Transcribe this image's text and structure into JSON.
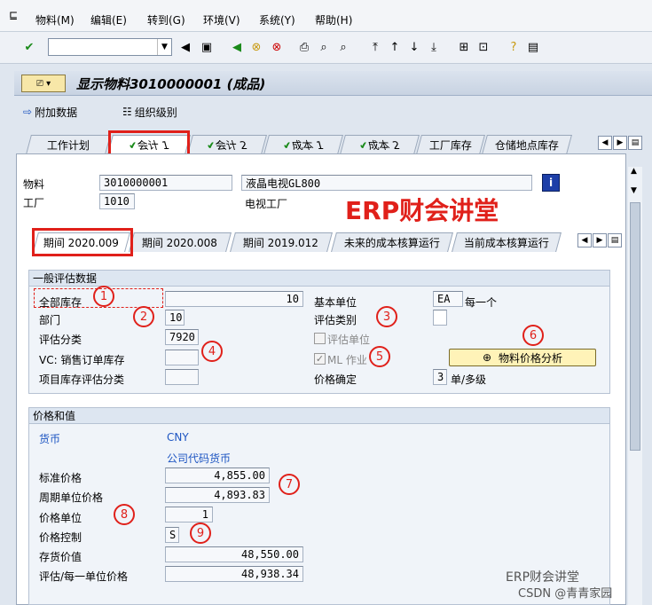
{
  "menu": [
    "物料(M)",
    "编辑(E)",
    "转到(G)",
    "环境(V)",
    "系统(Y)",
    "帮助(H)"
  ],
  "title": "显示物料3010000001 (成品)",
  "app_toolbar": {
    "additional_data": "附加数据",
    "org_levels": "组织级别"
  },
  "tabs": [
    "工作计划",
    "会计 1",
    "会计 2",
    "成本 1",
    "成本 2",
    "工厂库存",
    "仓储地点库存"
  ],
  "header": {
    "material_label": "物料",
    "material_value": "3010000001",
    "material_desc": "液晶电视GL800",
    "plant_label": "工厂",
    "plant_value": "1010",
    "plant_desc": "电视工厂"
  },
  "watermark": "ERP财会讲堂",
  "period_tabs": [
    "期间 2020.009",
    "期间 2020.008",
    "期间 2019.012",
    "未来的成本核算运行",
    "当前成本核算运行"
  ],
  "general": {
    "title": "一般评估数据",
    "total_stock_label": "全部库存",
    "total_stock_value": "10",
    "base_unit_label": "基本单位",
    "base_unit_value": "EA",
    "base_unit_desc": "每一个",
    "division_label": "部门",
    "division_value": "10",
    "val_category_label": "评估类别",
    "val_class_label": "评估分类",
    "val_class_value": "7920",
    "valuated_un_label": "评估单位",
    "vc_label": "VC: 销售订单库存",
    "ml_label": "ML 作业",
    "price_analysis_button": "物料价格分析",
    "project_label": "项目库存评估分类",
    "price_det_label": "价格确定",
    "price_det_value": "3",
    "price_det_desc": "单/多级"
  },
  "prices": {
    "title": "价格和值",
    "currency_label": "货币",
    "currency_value": "CNY",
    "currency_desc": "公司代码货币",
    "std_price_label": "标准价格",
    "std_price_value": "4,855.00",
    "periodic_price_label": "周期单位价格",
    "periodic_price_value": "4,893.83",
    "price_unit_label": "价格单位",
    "price_unit_value": "1",
    "price_control_label": "价格控制",
    "price_control_value": "S",
    "stock_value_label": "存货价值",
    "stock_value_value": "48,550.00",
    "per_unit_label": "评估/每一单位价格",
    "per_unit_value": "48,938.34"
  },
  "annotations": [
    "1",
    "2",
    "3",
    "4",
    "5",
    "6",
    "7",
    "8",
    "9"
  ],
  "footer_watermark": {
    "line1": "ERP财会讲堂",
    "line2": "CSDN @青青家园"
  },
  "colors": {
    "red": "#e0201a",
    "blue_text": "#1d55c2",
    "panel_bg": "#f0f4f9"
  }
}
